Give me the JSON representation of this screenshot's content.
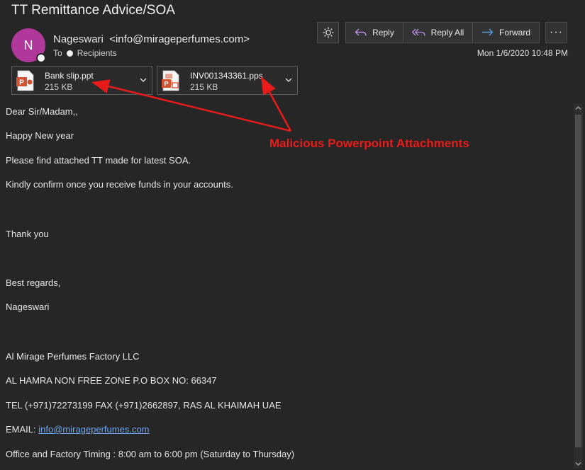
{
  "email": {
    "subject": "TT Remittance Advice/SOA",
    "avatar_initial": "N",
    "sender_name": "Nageswari",
    "sender_email": "<info@mirageperfumes.com>",
    "to_label": "To",
    "recipients_label": "Recipients",
    "date": "Mon 1/6/2020 10:48 PM"
  },
  "toolbar": {
    "reply_label": "Reply",
    "reply_all_label": "Reply All",
    "forward_label": "Forward",
    "more_label": "···"
  },
  "attachments": [
    {
      "name": "Bank slip.ppt",
      "size": "215 KB"
    },
    {
      "name": "INV001343361.pps",
      "size": "215 KB"
    }
  ],
  "body": {
    "greeting": "Dear Sir/Madam,,",
    "line1": "Happy New year",
    "line2": "Please find attached TT made for latest SOA.",
    "line3": "Kindly confirm once you receive funds in your accounts.",
    "thanks": "Thank you",
    "regards": "Best regards,",
    "signature_name": "Nageswari",
    "company": "Al Mirage Perfumes Factory LLC",
    "address": "AL HAMRA NON FREE ZONE P.O BOX NO: 66347",
    "phone": "TEL (+971)72273199 FAX (+971)2662897, RAS AL KHAIMAH UAE",
    "email_label": "EMAIL: ",
    "email_link": "info@mirageperfumes.com",
    "timing": "Office and Factory Timing : 8:00 am to 6:00 pm (Saturday to Thursday)"
  },
  "annotation": {
    "text": "Malicious Powerpoint Attachments",
    "color": "#e81b1b"
  },
  "colors": {
    "background": "#262626",
    "avatar": "#b0389b",
    "link": "#6ea6f0",
    "accent": "#5b9bd5"
  }
}
